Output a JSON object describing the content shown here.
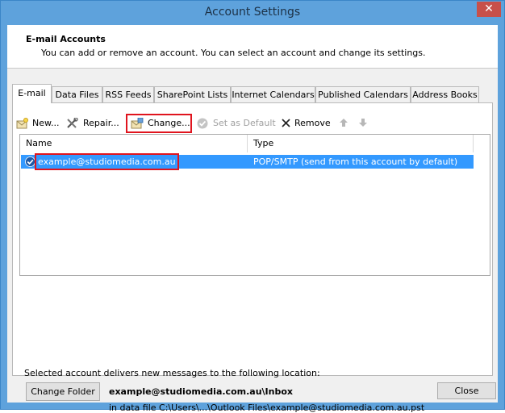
{
  "window": {
    "title": "Account Settings",
    "close_glyph": "✕"
  },
  "header": {
    "title": "E-mail Accounts",
    "description": "You can add or remove an account. You can select an account and change its settings."
  },
  "tabs": [
    {
      "label": "E-mail",
      "active": true
    },
    {
      "label": "Data Files"
    },
    {
      "label": "RSS Feeds"
    },
    {
      "label": "SharePoint Lists"
    },
    {
      "label": "Internet Calendars"
    },
    {
      "label": "Published Calendars"
    },
    {
      "label": "Address Books"
    }
  ],
  "toolbar": {
    "new_label": "New...",
    "repair_label": "Repair...",
    "change_label": "Change...",
    "set_default_label": "Set as Default",
    "remove_label": "Remove"
  },
  "accounts": {
    "columns": {
      "name": "Name",
      "type": "Type"
    },
    "rows": [
      {
        "name": "example@studiomedia.com.au",
        "type": "POP/SMTP (send from this account by default)",
        "selected": true
      }
    ]
  },
  "delivery": {
    "description": "Selected account delivers new messages to the following location:",
    "change_folder_label": "Change Folder",
    "folder": "example@studiomedia.com.au\\Inbox",
    "data_file": "in data file C:\\Users\\...\\Outlook Files\\example@studiomedia.com.au.pst"
  },
  "footer": {
    "close_label": "Close"
  },
  "colors": {
    "selection": "#3399ff",
    "highlight_box": "#e0141e",
    "title_bar": "#5ea2dc"
  }
}
